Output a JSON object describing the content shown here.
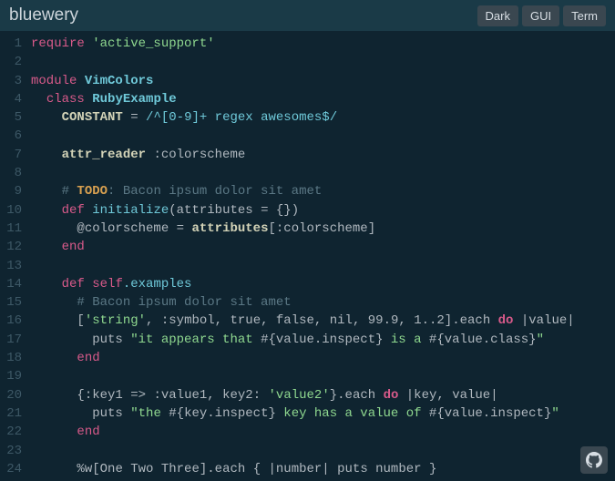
{
  "header": {
    "title": "bluewery",
    "buttons": {
      "dark": "Dark",
      "gui": "GUI",
      "term": "Term"
    }
  },
  "code": {
    "lines": [
      {
        "n": 1,
        "t": [
          [
            "kw-require",
            "require"
          ],
          [
            "txt",
            " "
          ],
          [
            "str",
            "'active_support'"
          ]
        ]
      },
      {
        "n": 2,
        "t": []
      },
      {
        "n": 3,
        "t": [
          [
            "kw-module",
            "module"
          ],
          [
            "txt",
            " "
          ],
          [
            "classname",
            "VimColors"
          ]
        ]
      },
      {
        "n": 4,
        "t": [
          [
            "txt",
            "  "
          ],
          [
            "kw-class",
            "class"
          ],
          [
            "txt",
            " "
          ],
          [
            "classname",
            "RubyExample"
          ]
        ]
      },
      {
        "n": 5,
        "t": [
          [
            "txt",
            "    "
          ],
          [
            "const",
            "CONSTANT"
          ],
          [
            "txt",
            " "
          ],
          [
            "eq",
            "="
          ],
          [
            "txt",
            " "
          ],
          [
            "regex",
            "/^"
          ],
          [
            "regex",
            "[0-9]"
          ],
          [
            "regex",
            "+ regex awesomes$/"
          ]
        ]
      },
      {
        "n": 6,
        "t": []
      },
      {
        "n": 7,
        "t": [
          [
            "txt",
            "    "
          ],
          [
            "attr",
            "attr_reader"
          ],
          [
            "txt",
            " "
          ],
          [
            "sym",
            ":colorscheme"
          ]
        ]
      },
      {
        "n": 8,
        "t": []
      },
      {
        "n": 9,
        "t": [
          [
            "txt",
            "    "
          ],
          [
            "comm",
            "# "
          ],
          [
            "todo",
            "TODO"
          ],
          [
            "comm",
            ": Bacon ipsum dolor sit amet"
          ]
        ]
      },
      {
        "n": 10,
        "t": [
          [
            "txt",
            "    "
          ],
          [
            "kw-def",
            "def"
          ],
          [
            "txt",
            " "
          ],
          [
            "method",
            "initialize"
          ],
          [
            "punct",
            "("
          ],
          [
            "param",
            "attributes"
          ],
          [
            "txt",
            " "
          ],
          [
            "eq",
            "="
          ],
          [
            "txt",
            " "
          ],
          [
            "punct",
            "{})"
          ]
        ]
      },
      {
        "n": 11,
        "t": [
          [
            "txt",
            "      "
          ],
          [
            "ivar",
            "@colorscheme"
          ],
          [
            "txt",
            " "
          ],
          [
            "eq",
            "="
          ],
          [
            "txt",
            " "
          ],
          [
            "attr",
            "attributes"
          ],
          [
            "punct",
            "["
          ],
          [
            "sym",
            ":colorscheme"
          ],
          [
            "punct",
            "]"
          ]
        ]
      },
      {
        "n": 12,
        "t": [
          [
            "txt",
            "    "
          ],
          [
            "kw-end",
            "end"
          ]
        ]
      },
      {
        "n": 13,
        "t": []
      },
      {
        "n": 14,
        "t": [
          [
            "txt",
            "    "
          ],
          [
            "kw-def",
            "def"
          ],
          [
            "txt",
            " "
          ],
          [
            "kw-self",
            "self"
          ],
          [
            "method",
            ".examples"
          ]
        ]
      },
      {
        "n": 15,
        "t": [
          [
            "txt",
            "      "
          ],
          [
            "comm",
            "# Bacon ipsum dolor sit amet"
          ]
        ]
      },
      {
        "n": 16,
        "t": [
          [
            "txt",
            "      "
          ],
          [
            "punct",
            "["
          ],
          [
            "str",
            "'string'"
          ],
          [
            "punct",
            ", "
          ],
          [
            "sym",
            ":symbol"
          ],
          [
            "punct",
            ", "
          ],
          [
            "bool-t",
            "true"
          ],
          [
            "punct",
            ", "
          ],
          [
            "bool-f",
            "false"
          ],
          [
            "punct",
            ", "
          ],
          [
            "nil",
            "nil"
          ],
          [
            "punct",
            ", "
          ],
          [
            "num",
            "99.9"
          ],
          [
            "punct",
            ", "
          ],
          [
            "num",
            "1..2"
          ],
          [
            "punct",
            "]."
          ],
          [
            "txt",
            "each"
          ],
          [
            "txt",
            " "
          ],
          [
            "kw-do",
            "do"
          ],
          [
            "txt",
            " "
          ],
          [
            "block",
            "|value|"
          ]
        ]
      },
      {
        "n": 17,
        "t": [
          [
            "txt",
            "        "
          ],
          [
            "txt",
            "puts "
          ],
          [
            "str",
            "\"it appears that "
          ],
          [
            "interp",
            "#{"
          ],
          [
            "txt",
            "value.inspect"
          ],
          [
            "interp",
            "}"
          ],
          [
            "str",
            " is a "
          ],
          [
            "interp",
            "#{"
          ],
          [
            "txt",
            "value.class"
          ],
          [
            "interp",
            "}"
          ],
          [
            "str",
            "\""
          ]
        ]
      },
      {
        "n": 18,
        "t": [
          [
            "txt",
            "      "
          ],
          [
            "kw-end",
            "end"
          ]
        ]
      },
      {
        "n": 19,
        "t": []
      },
      {
        "n": 20,
        "t": [
          [
            "txt",
            "      "
          ],
          [
            "punct",
            "{"
          ],
          [
            "sym",
            ":key1"
          ],
          [
            "txt",
            " "
          ],
          [
            "punct",
            "=>"
          ],
          [
            "txt",
            " "
          ],
          [
            "sym",
            ":value1"
          ],
          [
            "punct",
            ", "
          ],
          [
            "txt",
            "key2"
          ],
          [
            "punct",
            ": "
          ],
          [
            "str",
            "'value2'"
          ],
          [
            "punct",
            "}."
          ],
          [
            "txt",
            "each"
          ],
          [
            "txt",
            " "
          ],
          [
            "kw-do",
            "do"
          ],
          [
            "txt",
            " "
          ],
          [
            "block",
            "|key, value|"
          ]
        ]
      },
      {
        "n": 21,
        "t": [
          [
            "txt",
            "        "
          ],
          [
            "txt",
            "puts "
          ],
          [
            "str",
            "\"the "
          ],
          [
            "interp",
            "#{"
          ],
          [
            "txt",
            "key.inspect"
          ],
          [
            "interp",
            "}"
          ],
          [
            "str",
            " key has a value of "
          ],
          [
            "interp",
            "#{"
          ],
          [
            "txt",
            "value.inspect"
          ],
          [
            "interp",
            "}"
          ],
          [
            "str",
            "\""
          ]
        ]
      },
      {
        "n": 22,
        "t": [
          [
            "txt",
            "      "
          ],
          [
            "kw-end",
            "end"
          ]
        ]
      },
      {
        "n": 23,
        "t": []
      },
      {
        "n": 24,
        "t": [
          [
            "txt",
            "      "
          ],
          [
            "punct",
            "%w["
          ],
          [
            "txt",
            "One Two Three"
          ],
          [
            "punct",
            "]."
          ],
          [
            "txt",
            "each"
          ],
          [
            "txt",
            " "
          ],
          [
            "punct",
            "{ "
          ],
          [
            "block",
            "|number|"
          ],
          [
            "txt",
            " puts number "
          ],
          [
            "punct",
            "}"
          ]
        ]
      }
    ]
  },
  "icons": {
    "github": "github-icon"
  }
}
